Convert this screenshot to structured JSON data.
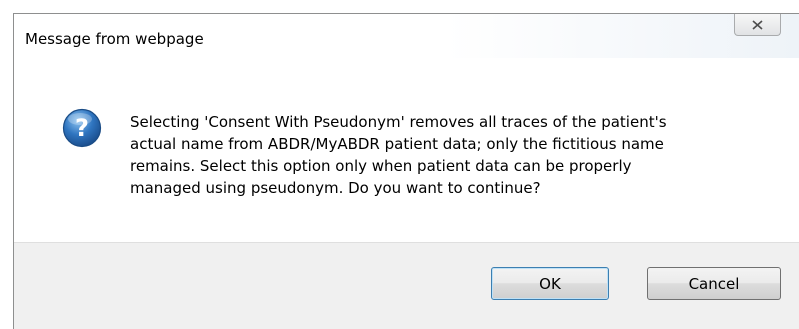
{
  "window": {
    "title": "Message from webpage",
    "close_icon": "close-x-icon"
  },
  "message": {
    "icon": "question-icon",
    "lines": [
      "Selecting 'Consent With Pseudonym' removes all traces of the patient's",
      "actual name from ABDR/MyABDR patient data; only the fictitious name",
      "remains. Select this option only when patient data can be properly",
      "managed using pseudonym. Do you want to continue?"
    ]
  },
  "buttons": {
    "ok_label": "OK",
    "cancel_label": "Cancel"
  },
  "colors": {
    "icon_blue": "#2b6fb6",
    "dialog_bg": "#f0f0f0",
    "body_bg": "#ffffff"
  }
}
